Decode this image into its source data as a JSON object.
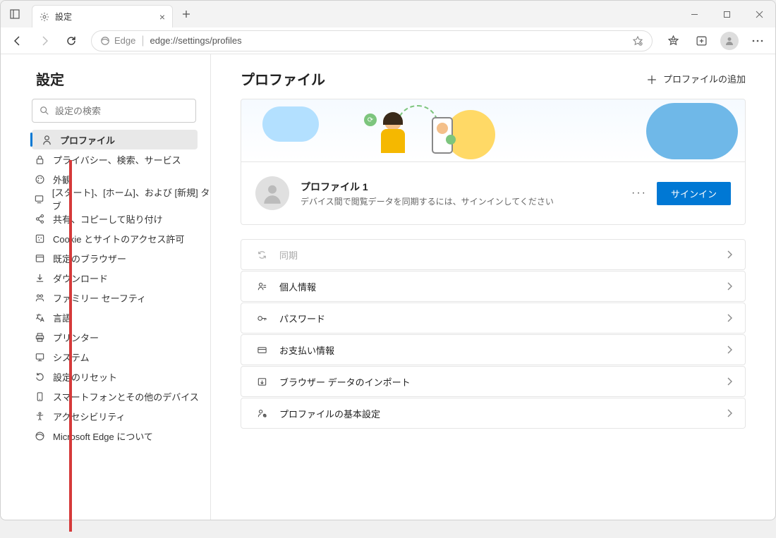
{
  "window": {
    "tab_title": "設定",
    "url_label": "Edge",
    "url": "edge://settings/profiles"
  },
  "sidebar": {
    "title": "設定",
    "search_placeholder": "設定の検索",
    "items": [
      {
        "label": "プロファイル",
        "icon": "person"
      },
      {
        "label": "プライバシー、検索、サービス",
        "icon": "lock"
      },
      {
        "label": "外観",
        "icon": "palette"
      },
      {
        "label": "[スタート]、[ホーム]、および [新規] タブ",
        "icon": "power"
      },
      {
        "label": "共有、コピーして貼り付け",
        "icon": "share"
      },
      {
        "label": "Cookie とサイトのアクセス許可",
        "icon": "cookie"
      },
      {
        "label": "既定のブラウザー",
        "icon": "browser"
      },
      {
        "label": "ダウンロード",
        "icon": "download"
      },
      {
        "label": "ファミリー セーフティ",
        "icon": "family"
      },
      {
        "label": "言語",
        "icon": "language"
      },
      {
        "label": "プリンター",
        "icon": "printer"
      },
      {
        "label": "システム",
        "icon": "system"
      },
      {
        "label": "設定のリセット",
        "icon": "reset"
      },
      {
        "label": "スマートフォンとその他のデバイス",
        "icon": "phone"
      },
      {
        "label": "アクセシビリティ",
        "icon": "accessibility"
      },
      {
        "label": "Microsoft Edge について",
        "icon": "edge"
      }
    ]
  },
  "main": {
    "heading": "プロファイル",
    "add_profile": "プロファイルの追加",
    "profile_name": "プロファイル 1",
    "profile_desc": "デバイス間で閲覧データを同期するには、サインインしてください",
    "signin": "サインイン",
    "options": [
      {
        "label": "同期",
        "icon": "sync",
        "disabled": true
      },
      {
        "label": "個人情報",
        "icon": "personal"
      },
      {
        "label": "パスワード",
        "icon": "key"
      },
      {
        "label": "お支払い情報",
        "icon": "card"
      },
      {
        "label": "ブラウザー データのインポート",
        "icon": "import"
      },
      {
        "label": "プロファイルの基本設定",
        "icon": "prefs"
      }
    ]
  }
}
